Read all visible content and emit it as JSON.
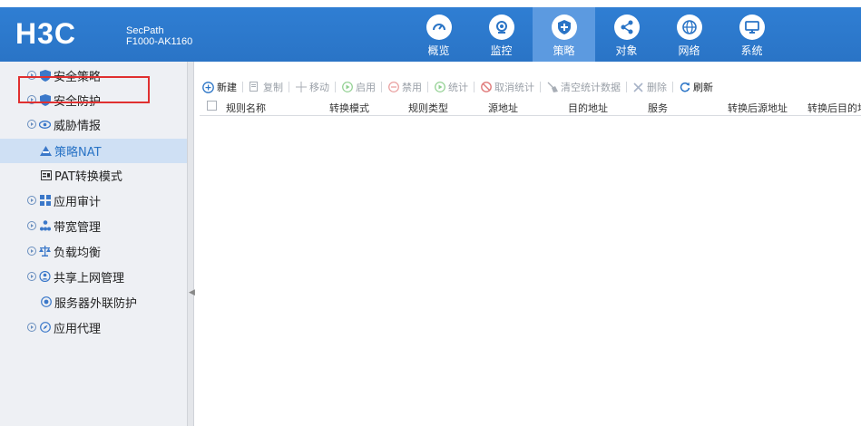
{
  "header": {
    "logo_text": "H3C",
    "product_line1": "SecPath",
    "product_line2": "F1000-AK1160",
    "nav": [
      {
        "label": "概览",
        "icon": "gauge-icon",
        "active": false
      },
      {
        "label": "监控",
        "icon": "camera-icon",
        "active": false
      },
      {
        "label": "策略",
        "icon": "shield-plus-icon",
        "active": true
      },
      {
        "label": "对象",
        "icon": "share-nodes-icon",
        "active": false
      },
      {
        "label": "网络",
        "icon": "globe-icon",
        "active": false
      },
      {
        "label": "系统",
        "icon": "monitor-icon",
        "active": false
      }
    ]
  },
  "sidebar": {
    "items": [
      {
        "label": "安全策略",
        "icon": "shield-icon"
      },
      {
        "label": "安全防护",
        "icon": "shield-icon"
      },
      {
        "label": "威胁情报",
        "icon": "eye-icon"
      },
      {
        "label": "策略NAT",
        "icon": "nat-icon"
      },
      {
        "label": "PAT转换模式",
        "icon": "pat-icon"
      },
      {
        "label": "应用审计",
        "icon": "grid-icon"
      },
      {
        "label": "带宽管理",
        "icon": "org-chart-icon"
      },
      {
        "label": "负载均衡",
        "icon": "balance-icon"
      },
      {
        "label": "共享上网管理",
        "icon": "users-icon"
      },
      {
        "label": "服务器外联防护",
        "icon": "target-icon"
      },
      {
        "label": "应用代理",
        "icon": "compass-icon"
      }
    ]
  },
  "toolbar": {
    "new": "新建",
    "copy": "复制",
    "move": "移动",
    "enable": "启用",
    "disable": "禁用",
    "stats": "统计",
    "cancel_stats": "取消统计",
    "clear_stats": "清空统计数据",
    "delete": "删除",
    "refresh": "刷新"
  },
  "table": {
    "columns": [
      "规则名称",
      "转换模式",
      "规则类型",
      "源地址",
      "目的地址",
      "服务",
      "转换后源地址",
      "转换后目的地址"
    ]
  },
  "colors": {
    "header_bg": "#2a74c6",
    "nav_active": "#5c9ae0",
    "selected_item": "#cfe0f4",
    "highlight_border": "#e03030"
  }
}
